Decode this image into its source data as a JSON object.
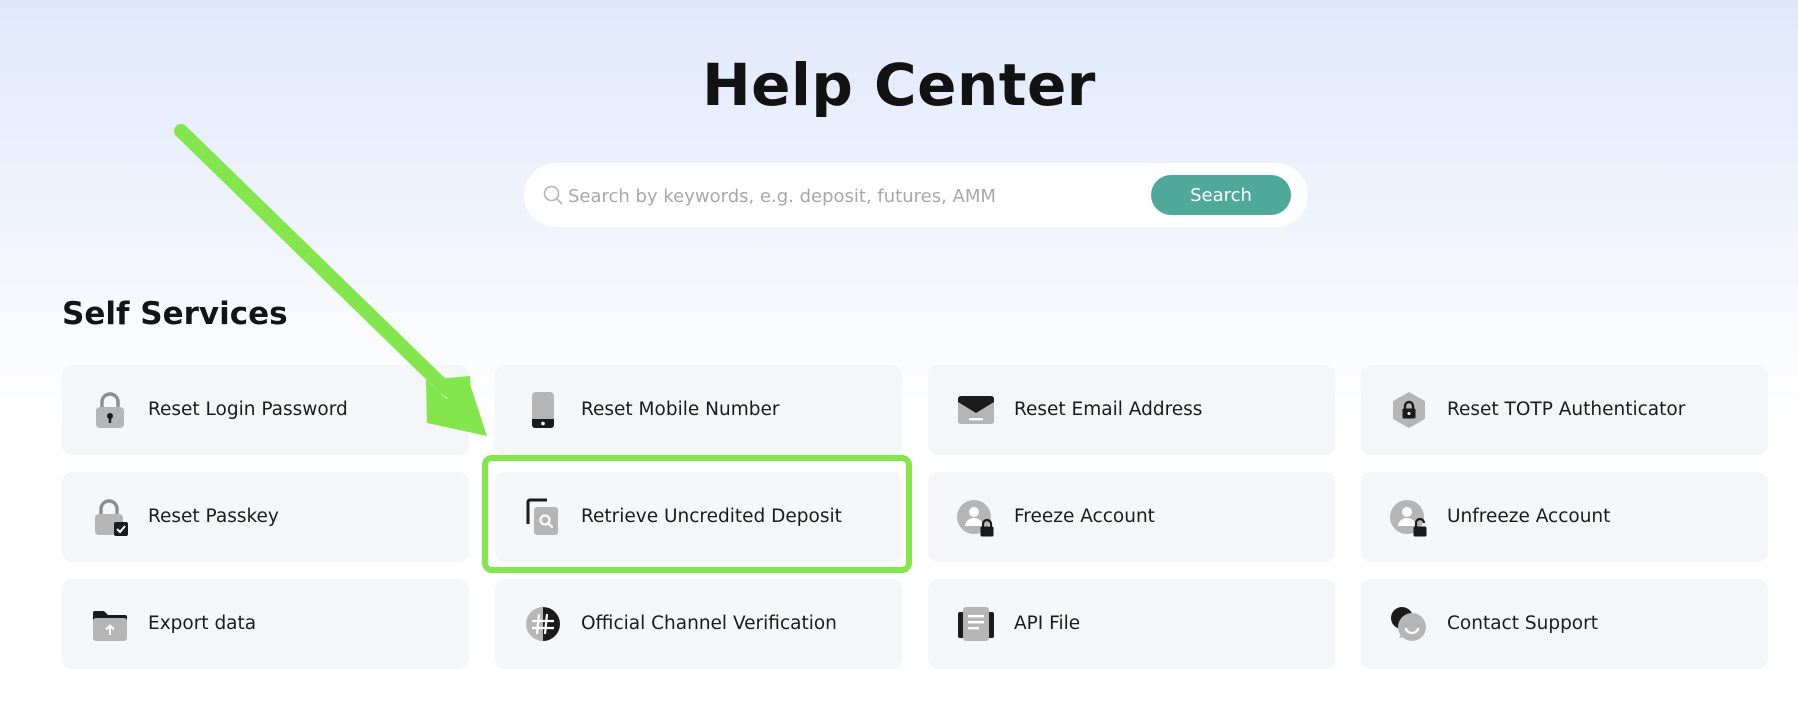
{
  "page": {
    "title": "Help Center"
  },
  "search": {
    "placeholder": "Search by keywords, e.g. deposit, futures, AMM",
    "value": "",
    "button_label": "Search",
    "button_color": "#4ea998"
  },
  "self_services": {
    "title": "Self Services",
    "items": [
      {
        "label": "Reset Login Password",
        "icon": "padlock-icon"
      },
      {
        "label": "Reset Mobile Number",
        "icon": "mobile-phone-icon"
      },
      {
        "label": "Reset Email Address",
        "icon": "envelope-icon"
      },
      {
        "label": "Reset TOTP Authenticator",
        "icon": "hexagon-lock-icon"
      },
      {
        "label": "Reset Passkey",
        "icon": "padlock-check-icon"
      },
      {
        "label": "Retrieve Uncredited Deposit",
        "icon": "document-search-icon"
      },
      {
        "label": "Freeze Account",
        "icon": "user-lock-icon"
      },
      {
        "label": "Unfreeze Account",
        "icon": "user-unlock-icon"
      },
      {
        "label": "Export data",
        "icon": "folder-upload-icon"
      },
      {
        "label": "Official Channel Verification",
        "icon": "hashtag-icon"
      },
      {
        "label": "API File",
        "icon": "file-stack-icon"
      },
      {
        "label": "Contact Support",
        "icon": "chat-bubble-icon"
      }
    ]
  },
  "annotation": {
    "highlight_color": "#82e64c",
    "highlighted_item": "Retrieve Uncredited Deposit"
  }
}
